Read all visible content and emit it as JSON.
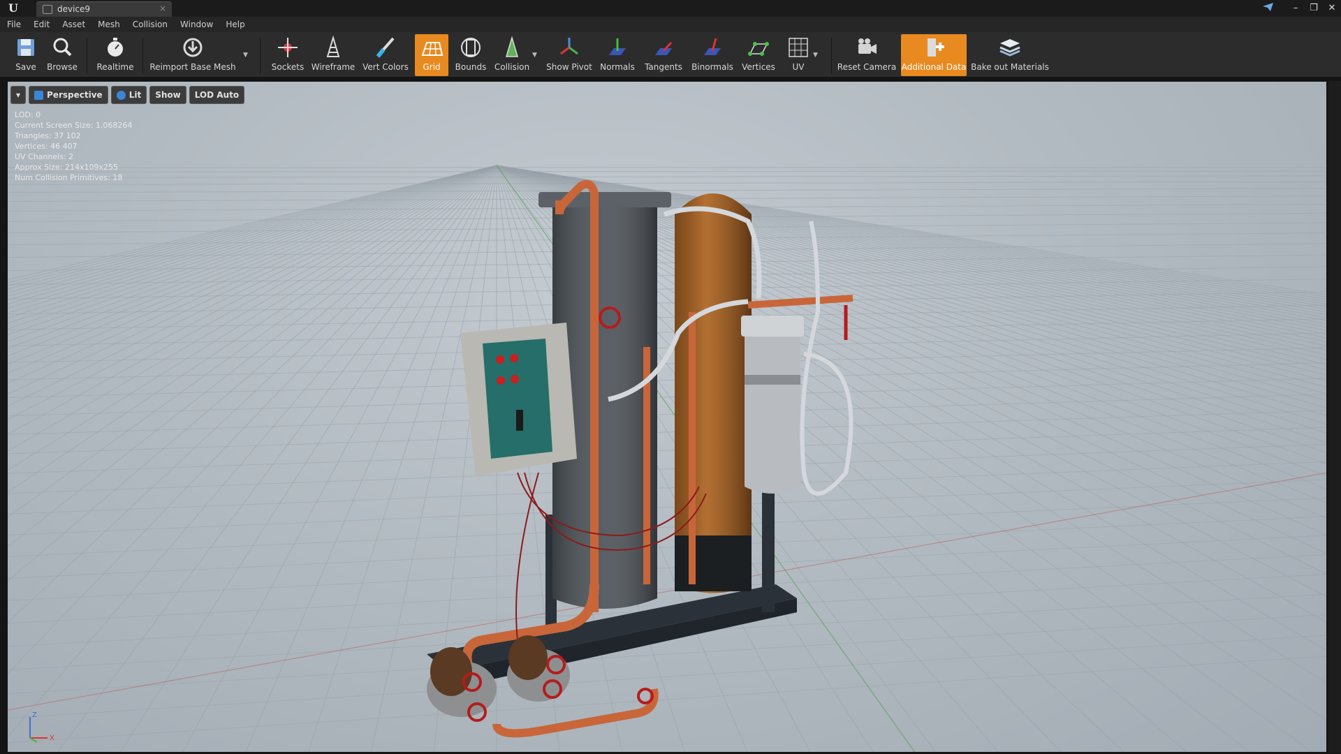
{
  "window": {
    "tab_title": "device9",
    "tab_close": "×",
    "controls": {
      "minimize": "–",
      "restore": "❐",
      "close": "✕"
    }
  },
  "menu": [
    "File",
    "Edit",
    "Asset",
    "Mesh",
    "Collision",
    "Window",
    "Help"
  ],
  "toolbar": {
    "save": "Save",
    "browse": "Browse",
    "realtime": "Realtime",
    "reimport": "Reimport Base Mesh",
    "sockets": "Sockets",
    "wireframe": "Wireframe",
    "vert_colors": "Vert Colors",
    "grid": "Grid",
    "bounds": "Bounds",
    "collision": "Collision",
    "show_pivot": "Show Pivot",
    "normals": "Normals",
    "tangents": "Tangents",
    "binormals": "Binormals",
    "vertices": "Vertices",
    "uv": "UV",
    "reset_camera": "Reset Camera",
    "additional_data": "Additional Data",
    "bake_out": "Bake out Materials"
  },
  "viewport": {
    "options_menu": "▾",
    "perspective": "Perspective",
    "lit": "Lit",
    "show": "Show",
    "lod": "LOD Auto",
    "stats": [
      "LOD:  0",
      "Current Screen Size:  1,068264",
      "Triangles:  37 102",
      "Vertices:  46 407",
      "UV Channels:  2",
      "Approx Size: 214x109x255",
      "Num Collision Primitives:  18"
    ],
    "axis": {
      "z": "Z",
      "x": "X"
    }
  },
  "colors": {
    "accent": "#e88a1f",
    "check": "#3a86d6"
  }
}
